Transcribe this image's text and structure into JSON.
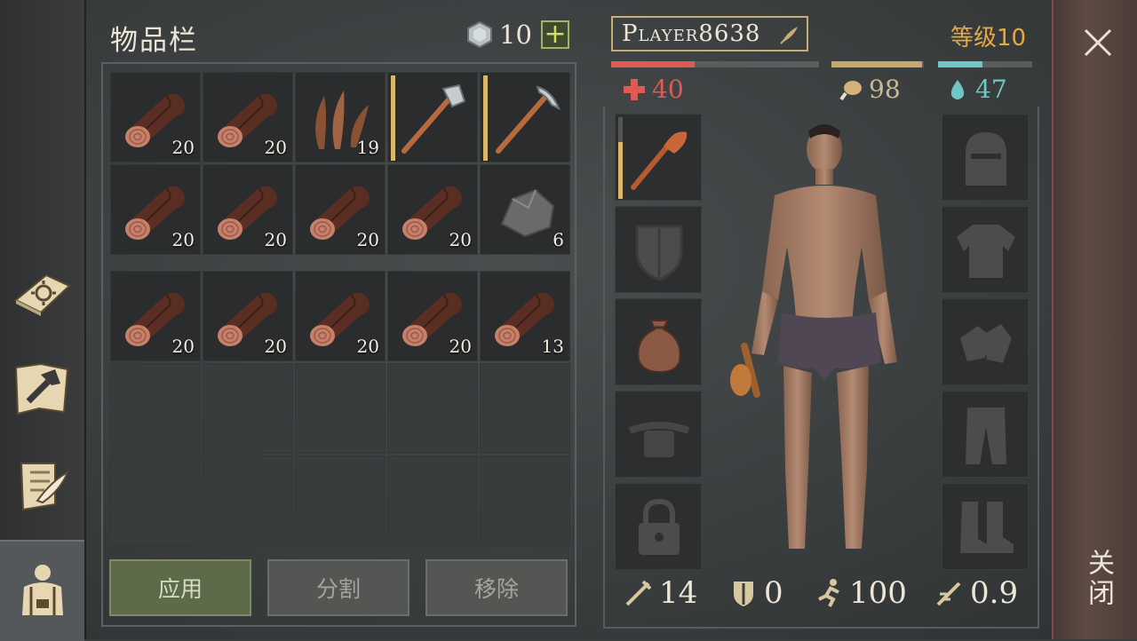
{
  "inventory": {
    "title": "物品栏",
    "currency_value": "10",
    "rows": [
      [
        {
          "item": "log",
          "qty": "20"
        },
        {
          "item": "log",
          "qty": "20"
        },
        {
          "item": "fiber",
          "qty": "19"
        },
        {
          "item": "stone-axe",
          "qty": "",
          "durability": 1.0
        },
        {
          "item": "stone-pickaxe",
          "qty": "",
          "durability": 1.0
        }
      ],
      [
        {
          "item": "log",
          "qty": "20"
        },
        {
          "item": "log",
          "qty": "20"
        },
        {
          "item": "log",
          "qty": "20"
        },
        {
          "item": "log",
          "qty": "20"
        },
        {
          "item": "stone",
          "qty": "6"
        }
      ]
    ],
    "rows2": [
      [
        {
          "item": "log",
          "qty": "20"
        },
        {
          "item": "log",
          "qty": "20"
        },
        {
          "item": "log",
          "qty": "20"
        },
        {
          "item": "log",
          "qty": "20"
        },
        {
          "item": "log",
          "qty": "13"
        }
      ],
      [
        {
          "item": "",
          "qty": ""
        },
        {
          "item": "",
          "qty": ""
        },
        {
          "item": "",
          "qty": ""
        },
        {
          "item": "",
          "qty": ""
        },
        {
          "item": "",
          "qty": ""
        }
      ],
      [
        {
          "item": "",
          "qty": ""
        },
        {
          "item": "",
          "qty": ""
        },
        {
          "item": "",
          "qty": ""
        },
        {
          "item": "",
          "qty": ""
        },
        {
          "item": "",
          "qty": ""
        }
      ]
    ],
    "buttons": {
      "apply": "应用",
      "split": "分割",
      "remove": "移除"
    }
  },
  "character": {
    "name": "Player8638",
    "level": "等级10",
    "health": "40",
    "food": "98",
    "water": "47",
    "health_fraction": 0.4,
    "food_fraction": 0.98,
    "water_fraction": 0.47,
    "left_slots": [
      "club",
      "shield",
      "bag",
      "belt",
      "locked"
    ],
    "right_slots": [
      "helmet",
      "shirt",
      "gloves",
      "pants",
      "boots"
    ],
    "attack": "14",
    "armor": "0",
    "speed": "100",
    "attack_speed": "0.9"
  },
  "close_label": "关闭",
  "colors": {
    "health": "#e05a52",
    "food": "#c8a86a",
    "water": "#6ec6c6",
    "level": "#e8a840"
  }
}
